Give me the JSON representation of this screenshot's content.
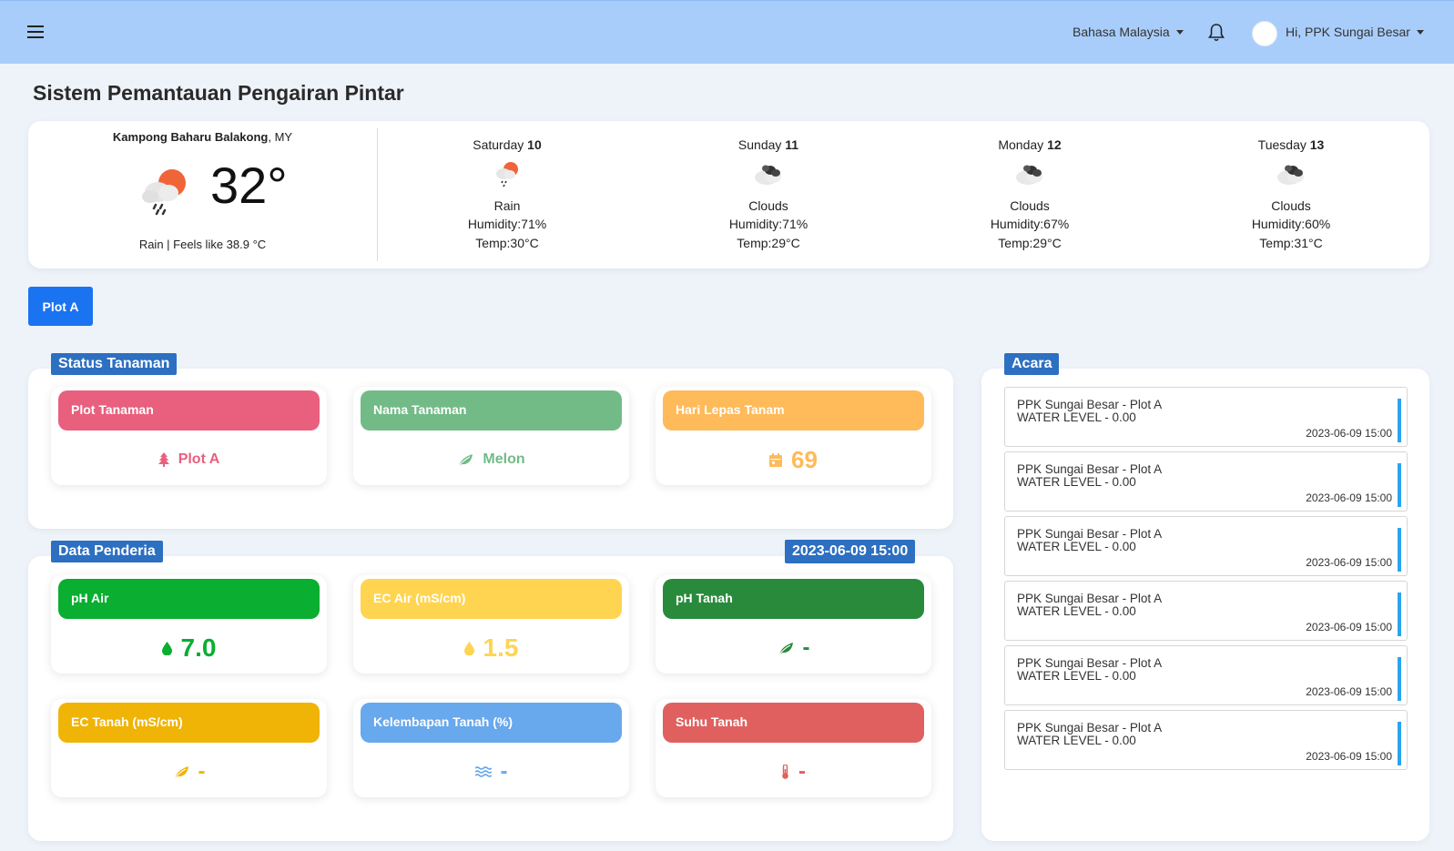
{
  "topbar": {
    "language": "Bahasa Malaysia",
    "greeting": "Hi, PPK Sungai Besar"
  },
  "page_title": "Sistem Pemantauan Pengairan Pintar",
  "weather": {
    "location": "Kampong Baharu Balakong",
    "country": ", MY",
    "temperature": "32°",
    "description": "Rain | Feels like 38.9 °C",
    "forecast": [
      {
        "day": "Saturday",
        "date": "10",
        "condition": "Rain",
        "humidity": "Humidity:71%",
        "temp": "Temp:30°C",
        "icon": "rain-icon"
      },
      {
        "day": "Sunday",
        "date": "11",
        "condition": "Clouds",
        "humidity": "Humidity:71%",
        "temp": "Temp:29°C",
        "icon": "clouds-icon"
      },
      {
        "day": "Monday",
        "date": "12",
        "condition": "Clouds",
        "humidity": "Humidity:67%",
        "temp": "Temp:29°C",
        "icon": "clouds-icon"
      },
      {
        "day": "Tuesday",
        "date": "13",
        "condition": "Clouds",
        "humidity": "Humidity:60%",
        "temp": "Temp:31°C",
        "icon": "clouds-icon"
      }
    ]
  },
  "plot_button": "Plot A",
  "status": {
    "tag": "Status Tanaman",
    "cards": [
      {
        "title": "Plot Tanaman",
        "value": "Plot A",
        "color": "#e8607e",
        "icon": "tree-icon"
      },
      {
        "title": "Nama Tanaman",
        "value": "Melon",
        "color": "#72bb87",
        "icon": "leaf-icon"
      },
      {
        "title": "Hari Lepas Tanam",
        "value": "69",
        "color": "#ffba59",
        "icon": "calendar-icon"
      }
    ]
  },
  "sensor": {
    "tag": "Data Penderia",
    "datetime": "2023-06-09 15:00",
    "cards": [
      {
        "title": "pH Air",
        "value": "7.0",
        "color": "#0aae30",
        "icon": "droplet-icon"
      },
      {
        "title": "EC Air (mS/cm)",
        "value": "1.5",
        "color": "#ffd451",
        "icon": "droplet-icon"
      },
      {
        "title": "pH Tanah",
        "value": "-",
        "color": "#2a8a3c",
        "icon": "leaf-icon"
      },
      {
        "title": "EC Tanah (mS/cm)",
        "value": "-",
        "color": "#f0b406",
        "icon": "leaf-icon"
      },
      {
        "title": "Kelembapan Tanah (%)",
        "value": "-",
        "color": "#68a8ec",
        "icon": "water-waves-icon"
      },
      {
        "title": "Suhu Tanah",
        "value": "-",
        "color": "#e06060",
        "icon": "thermometer-icon"
      }
    ]
  },
  "events": {
    "tag": "Acara",
    "items": [
      {
        "title": "PPK Sungai Besar - Plot A",
        "detail": "WATER LEVEL - 0.00",
        "time": "2023-06-09 15:00"
      },
      {
        "title": "PPK Sungai Besar - Plot A",
        "detail": "WATER LEVEL - 0.00",
        "time": "2023-06-09 15:00"
      },
      {
        "title": "PPK Sungai Besar - Plot A",
        "detail": "WATER LEVEL - 0.00",
        "time": "2023-06-09 15:00"
      },
      {
        "title": "PPK Sungai Besar - Plot A",
        "detail": "WATER LEVEL - 0.00",
        "time": "2023-06-09 15:00"
      },
      {
        "title": "PPK Sungai Besar - Plot A",
        "detail": "WATER LEVEL - 0.00",
        "time": "2023-06-09 15:00"
      },
      {
        "title": "PPK Sungai Besar - Plot A",
        "detail": "WATER LEVEL - 0.00",
        "time": "2023-06-09 15:00"
      }
    ]
  }
}
